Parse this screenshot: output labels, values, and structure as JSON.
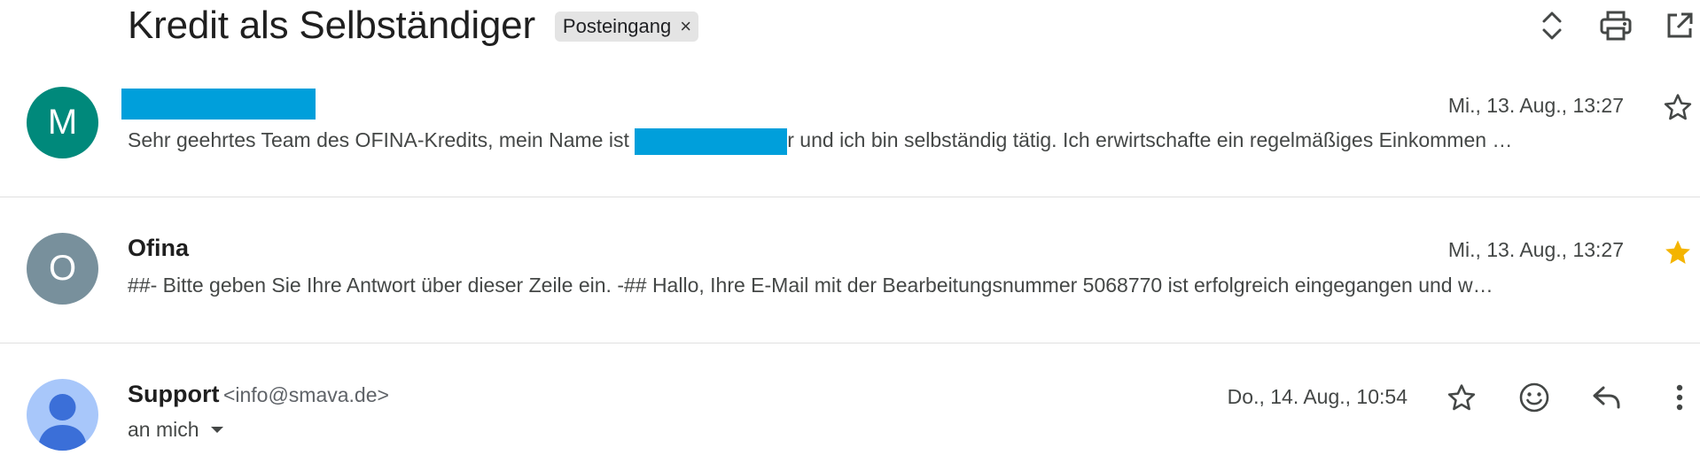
{
  "subject": {
    "title": "Kredit als Selbständiger",
    "label": "Posteingang",
    "label_remove": "×"
  },
  "toolbar": {
    "icons": [
      "expand-collapse-icon",
      "print-icon",
      "open-in-new-window-icon"
    ]
  },
  "messages": [
    {
      "avatar_letter": "M",
      "avatar_color": "#00897b",
      "sender": "",
      "sender_redacted": true,
      "date": "Mi., 13. Aug., 13:27",
      "starred": false,
      "snippet_before": "Sehr geehrtes Team des OFINA-Kredits, mein Name ist ",
      "snippet_after": "r und ich bin selbständig tätig. Ich erwirtschafte ein regelmäßiges Einkommen …"
    },
    {
      "avatar_letter": "O",
      "avatar_color": "#78909c",
      "sender": "Ofina",
      "date": "Mi., 13. Aug., 13:27",
      "starred": true,
      "snippet": "##- Bitte geben Sie Ihre Antwort über dieser Zeile ein. -## Hallo, Ihre E-Mail mit der Bearbeitungsnummer 5068770 ist erfolgreich eingegangen und w…"
    },
    {
      "avatar_color": "#a8c7fa",
      "sender": "Support",
      "sender_email": "<info@smava.de>",
      "recipient": "an mich",
      "date": "Do., 14. Aug., 10:54",
      "starred": false
    }
  ],
  "colors": {
    "star_filled": "#f4b400",
    "redaction": "#009fdb"
  }
}
